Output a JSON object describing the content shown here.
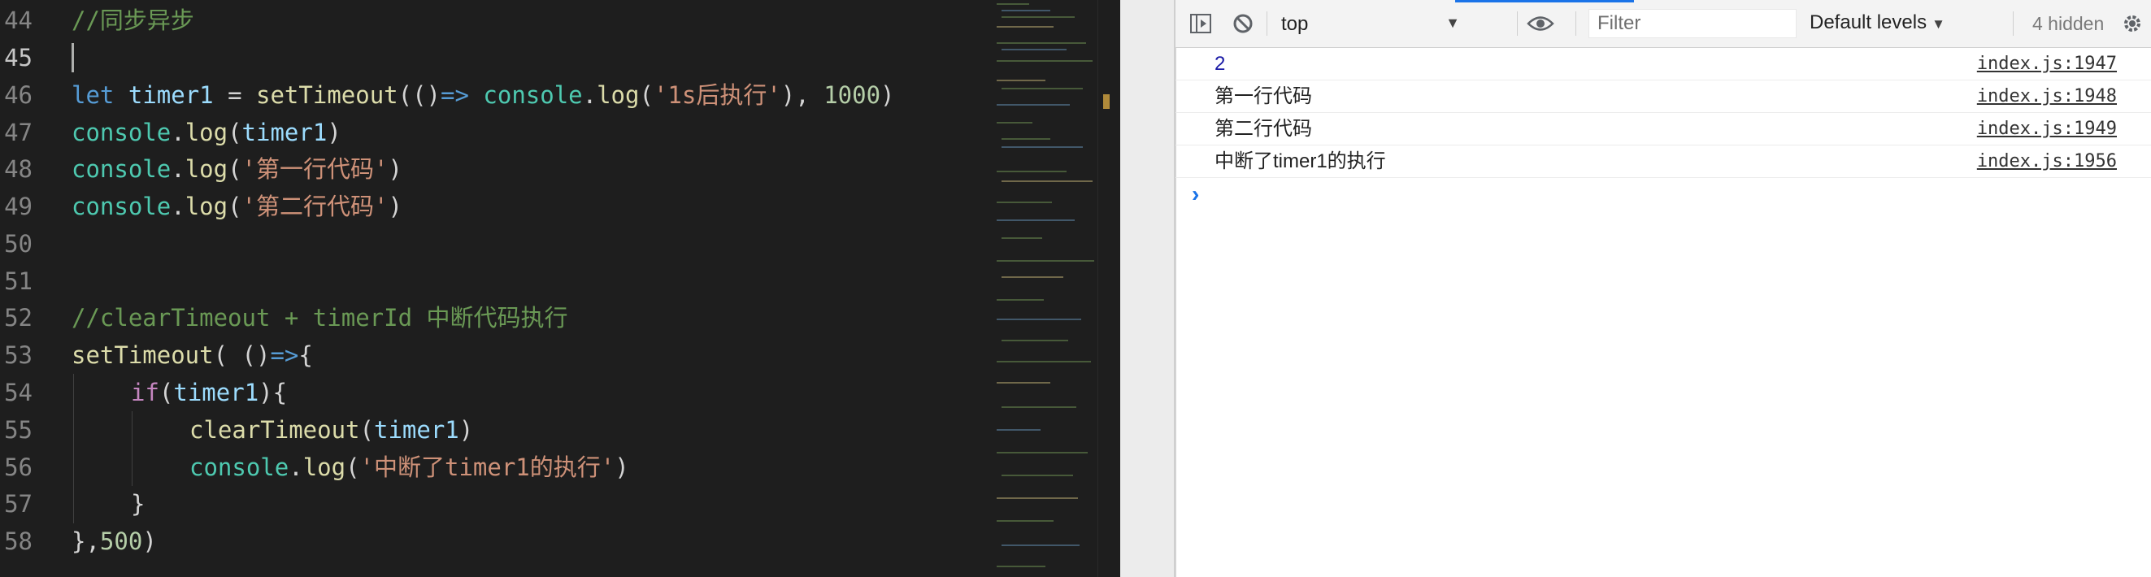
{
  "editor": {
    "line_numbers": [
      "44",
      "45",
      "46",
      "47",
      "48",
      "49",
      "50",
      "51",
      "52",
      "53",
      "54",
      "55",
      "56",
      "57",
      "58"
    ],
    "lines": {
      "l44": {
        "comment": "//同步异步"
      },
      "l46": {
        "let": "let",
        "timer1": "timer1",
        "eq": " = ",
        "setTimeout": "setTimeout",
        "p1": "((",
        "p2": ")",
        "arrow": "=>",
        "sp": " ",
        "console": "console",
        "dot": ".",
        "log": "log",
        "p3": "(",
        "str": "'1s后执行'",
        "p4": "), ",
        "num": "1000",
        "p5": ")"
      },
      "l47": {
        "console": "console",
        "dot": ".",
        "log": "log",
        "p1": "(",
        "arg": "timer1",
        "p2": ")"
      },
      "l48": {
        "console": "console",
        "dot": ".",
        "log": "log",
        "p1": "(",
        "str": "'第一行代码'",
        "p2": ")"
      },
      "l49": {
        "console": "console",
        "dot": ".",
        "log": "log",
        "p1": "(",
        "str": "'第二行代码'",
        "p2": ")"
      },
      "l52": {
        "comment": "//clearTimeout + timerId 中断代码执行"
      },
      "l53": {
        "setTimeout": "setTimeout",
        "p1": "( ()",
        "arrow": "=>",
        "p2": "{"
      },
      "l54": {
        "if": "if",
        "p1": "(",
        "arg": "timer1",
        "p2": "){"
      },
      "l55": {
        "fn": "clearTimeout",
        "p1": "(",
        "arg": "timer1",
        "p2": ")"
      },
      "l56": {
        "console": "console",
        "dot": ".",
        "log": "log",
        "p1": "(",
        "str": "'中断了timer1的执行'",
        "p2": ")"
      },
      "l57": {
        "brace": "}"
      },
      "l58": {
        "p1": "},",
        "num": "500",
        "p2": ")"
      }
    }
  },
  "devtools": {
    "context": "top",
    "filter_placeholder": "Filter",
    "levels": "Default levels",
    "hidden": "4 hidden",
    "rows": [
      {
        "msg": "2",
        "src": "index.js:1947"
      },
      {
        "msg": "第一行代码",
        "src": "index.js:1948"
      },
      {
        "msg": "第二行代码",
        "src": "index.js:1949"
      },
      {
        "msg": "中断了timer1的执行",
        "src": "index.js:1956"
      }
    ],
    "prompt": "›"
  },
  "colors": {
    "editor_bg": "#1e1e1e",
    "keyword": "#569cd6",
    "string": "#ce9178",
    "comment": "#6a9955",
    "function": "#dcdcaa",
    "accent": "#1a73e8"
  }
}
